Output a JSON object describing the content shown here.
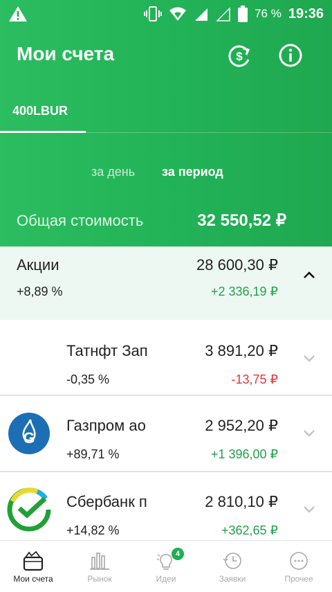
{
  "status_bar": {
    "battery": "76 %",
    "time": "19:36"
  },
  "header": {
    "title": "Мои счета"
  },
  "tabs": [
    {
      "label": "400LBUR",
      "active": true
    }
  ],
  "period": {
    "day_label": "за день",
    "period_label": "за период",
    "selected": "за период"
  },
  "total": {
    "label": "Общая стоимость",
    "value": "32 550,52 ₽"
  },
  "group": {
    "name": "Акции",
    "percent": "+8,89  %",
    "value": "28 600,30 ₽",
    "change": "+2 336,19 ₽",
    "expanded": true
  },
  "holdings": [
    {
      "name": "Татнфт Зап",
      "percent": "-0,35  %",
      "value": "3 891,20 ₽",
      "change": "-13,75 ₽",
      "direction": "down",
      "logo": "none"
    },
    {
      "name": "Газпром ао",
      "percent": "+89,71  %",
      "value": "2 952,20 ₽",
      "change": "+1 396,00 ₽",
      "direction": "up",
      "logo": "gazprom-logo"
    },
    {
      "name": "Сбербанк п",
      "percent": "+14,82  %",
      "value": "2 810,10 ₽",
      "change": "+362,65 ₽",
      "direction": "up",
      "logo": "sberbank-logo"
    }
  ],
  "nav": [
    {
      "label": "Мои счета",
      "icon": "wallet-icon",
      "active": true
    },
    {
      "label": "Рынок",
      "icon": "bar-chart-icon",
      "active": false
    },
    {
      "label": "Идеи",
      "icon": "lightbulb-icon",
      "active": false,
      "badge": "4"
    },
    {
      "label": "Заявки",
      "icon": "clock-icon",
      "active": false
    },
    {
      "label": "Прочее",
      "icon": "more-icon",
      "active": false
    }
  ],
  "colors": {
    "accent": "#21b157",
    "positive": "#21a04b",
    "negative": "#e0353a",
    "expanded_row_bg": "#eef8f2"
  }
}
